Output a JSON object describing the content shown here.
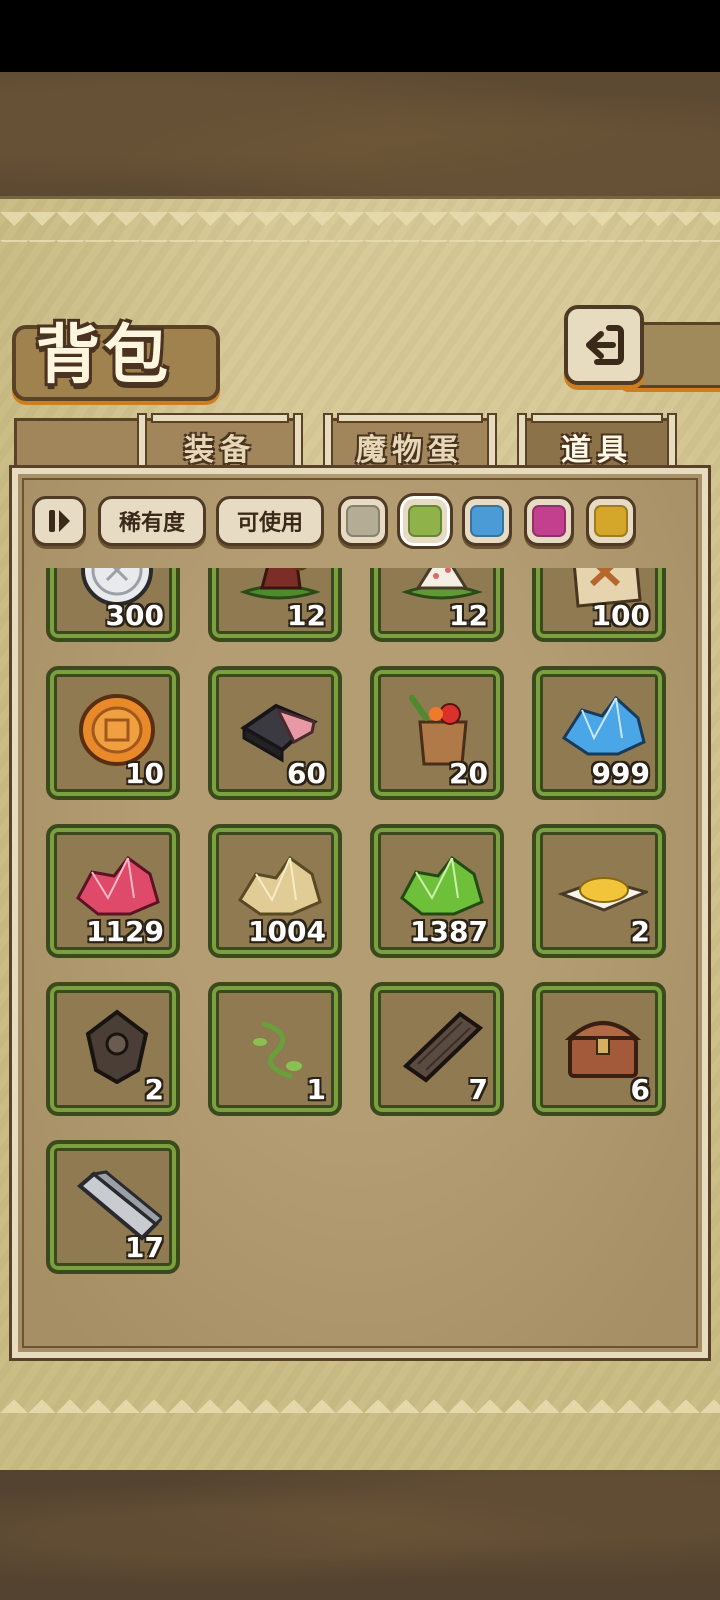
{
  "page": {
    "title": "背包"
  },
  "tabs": [
    {
      "label": "装备",
      "active": false
    },
    {
      "label": "魔物蛋",
      "active": false
    },
    {
      "label": "道具",
      "active": true
    }
  ],
  "filters": {
    "sort_icon": "sort-toggle-icon",
    "rarity_label": "稀有度",
    "usable_label": "可使用",
    "swatches": [
      {
        "name": "gray",
        "color": "#b5ac95",
        "selected": false
      },
      {
        "name": "green",
        "color": "#8fb24a",
        "selected": true
      },
      {
        "name": "blue",
        "color": "#4a9bd6",
        "selected": false
      },
      {
        "name": "magenta",
        "color": "#c2408e",
        "selected": false
      },
      {
        "name": "yellow",
        "color": "#d4a62a",
        "selected": false
      }
    ]
  },
  "items": [
    {
      "icon": "silver-coin-icon",
      "count": "300"
    },
    {
      "icon": "zongzi-meat-icon",
      "count": "12"
    },
    {
      "icon": "rice-dumpling-icon",
      "count": "12"
    },
    {
      "icon": "treasure-map-icon",
      "count": "100"
    },
    {
      "icon": "mooncake-icon",
      "count": "10"
    },
    {
      "icon": "gift-box-icon",
      "count": "60"
    },
    {
      "icon": "vegetable-bag-icon",
      "count": "20"
    },
    {
      "icon": "blue-crystal-icon",
      "count": "999"
    },
    {
      "icon": "red-crystal-icon",
      "count": "1129"
    },
    {
      "icon": "gold-ore-icon",
      "count": "1004"
    },
    {
      "icon": "green-crystal-icon",
      "count": "1387"
    },
    {
      "icon": "sugar-plate-icon",
      "count": "2"
    },
    {
      "icon": "dark-amulet-icon",
      "count": "2"
    },
    {
      "icon": "vine-sprout-icon",
      "count": "1"
    },
    {
      "icon": "wood-plank-icon",
      "count": "7"
    },
    {
      "icon": "treasure-chest-icon",
      "count": "6"
    },
    {
      "icon": "iron-bar-icon",
      "count": "17"
    }
  ]
}
